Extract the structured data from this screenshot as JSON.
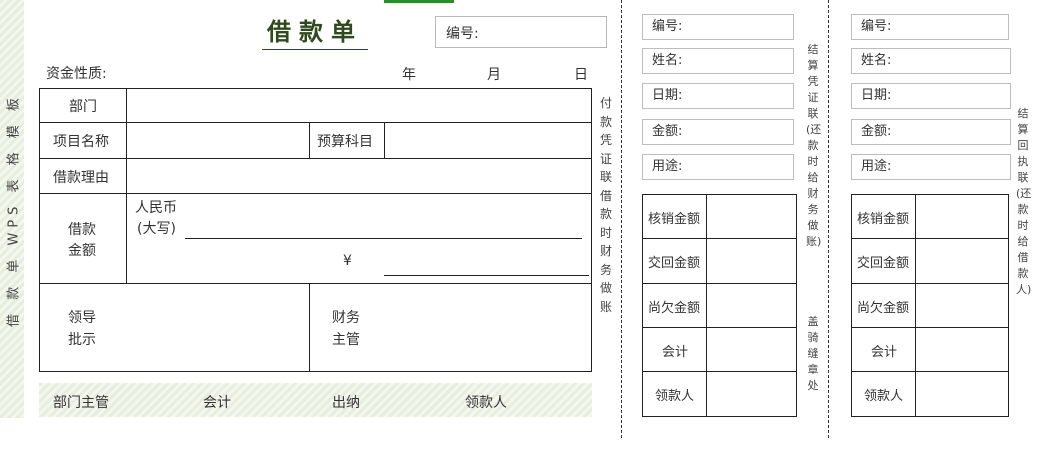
{
  "side": {
    "label": "借 款 单 WPS 表 格 模 板"
  },
  "header": {
    "title": "借款单",
    "number_label": "编号:",
    "fund_nature_label": "资金性质:",
    "year_label": "年",
    "month_label": "月",
    "day_label": "日"
  },
  "form": {
    "department_label": "部门",
    "project_label": "项目名称",
    "budget_label": "预算科目",
    "reason_label": "借款理由",
    "amount_label_1": "借款",
    "amount_label_2": "金额",
    "rmb_label": "人民币",
    "capital_label": "(大写)",
    "yen_symbol": "¥",
    "leader_label_1": "领导",
    "leader_label_2": "批示",
    "finance_label_1": "财务",
    "finance_label_2": "主管"
  },
  "footer": {
    "dept_head": "部门主管",
    "accountant": "会计",
    "cashier": "出纳",
    "recipient": "领款人"
  },
  "vertical": {
    "payment_voucher": "付款凭证联借款时财务做账",
    "settlement_voucher": "结算凭证联(还款时给财务做账)",
    "seal": "盖骑缝章处",
    "settlement_receipt": "结算回执联(还款时给借款人)"
  },
  "stub": {
    "number_label": "编号:",
    "name_label": "姓名:",
    "date_label": "日期:",
    "amount_label": "金额:",
    "purpose_label": "用途:",
    "writeoff_label": "核销金额",
    "returned_label": "交回金额",
    "owed_label": "尚欠金额",
    "accountant_label": "会计",
    "recipient_label": "领款人"
  }
}
